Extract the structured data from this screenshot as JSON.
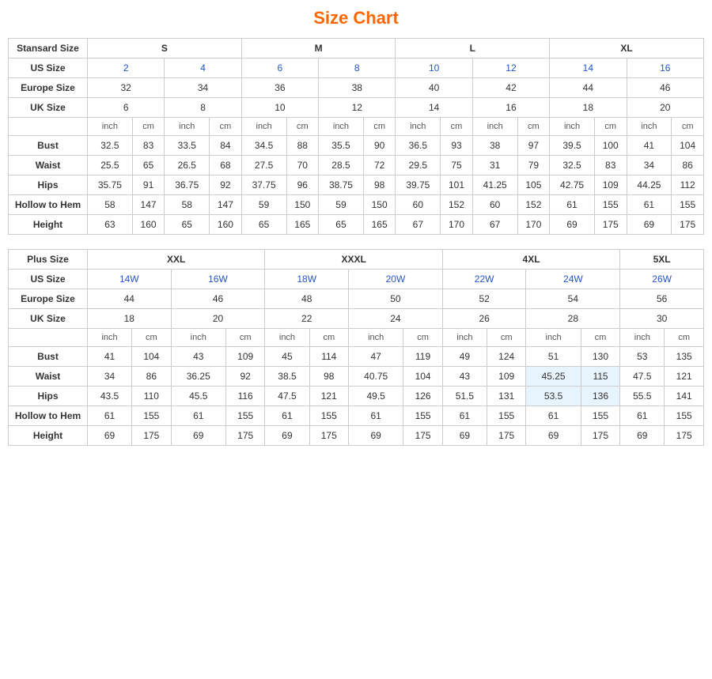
{
  "title": "Size Chart",
  "standard": {
    "headers": {
      "col1": "Stansard Size",
      "s": "S",
      "m": "M",
      "l": "L",
      "xl": "XL"
    },
    "us_size": {
      "label": "US Size",
      "values": [
        "2",
        "4",
        "6",
        "8",
        "10",
        "12",
        "14",
        "16"
      ]
    },
    "europe_size": {
      "label": "Europe Size",
      "values": [
        "32",
        "34",
        "36",
        "38",
        "40",
        "42",
        "44",
        "46"
      ]
    },
    "uk_size": {
      "label": "UK Size",
      "values": [
        "6",
        "8",
        "10",
        "12",
        "14",
        "16",
        "18",
        "20"
      ]
    },
    "unit_row": [
      "inch",
      "cm",
      "inch",
      "cm",
      "inch",
      "cm",
      "inch",
      "cm",
      "inch",
      "cm",
      "inch",
      "cm",
      "inch",
      "cm",
      "inch",
      "cm"
    ],
    "bust": {
      "label": "Bust",
      "values": [
        "32.5",
        "83",
        "33.5",
        "84",
        "34.5",
        "88",
        "35.5",
        "90",
        "36.5",
        "93",
        "38",
        "97",
        "39.5",
        "100",
        "41",
        "104"
      ]
    },
    "waist": {
      "label": "Waist",
      "values": [
        "25.5",
        "65",
        "26.5",
        "68",
        "27.5",
        "70",
        "28.5",
        "72",
        "29.5",
        "75",
        "31",
        "79",
        "32.5",
        "83",
        "34",
        "86"
      ]
    },
    "hips": {
      "label": "Hips",
      "values": [
        "35.75",
        "91",
        "36.75",
        "92",
        "37.75",
        "96",
        "38.75",
        "98",
        "39.75",
        "101",
        "41.25",
        "105",
        "42.75",
        "109",
        "44.25",
        "112"
      ]
    },
    "hollow": {
      "label": "Hollow to Hem",
      "values": [
        "58",
        "147",
        "58",
        "147",
        "59",
        "150",
        "59",
        "150",
        "60",
        "152",
        "60",
        "152",
        "61",
        "155",
        "61",
        "155"
      ]
    },
    "height": {
      "label": "Height",
      "values": [
        "63",
        "160",
        "65",
        "160",
        "65",
        "165",
        "65",
        "165",
        "67",
        "170",
        "67",
        "170",
        "69",
        "175",
        "69",
        "175"
      ]
    }
  },
  "plus": {
    "headers": {
      "col1": "Plus Size",
      "xxl": "XXL",
      "xxxl": "XXXL",
      "fourxl": "4XL",
      "fivexl": "5XL"
    },
    "us_size": {
      "label": "US Size",
      "values": [
        "14W",
        "16W",
        "18W",
        "20W",
        "22W",
        "24W",
        "26W"
      ]
    },
    "europe_size": {
      "label": "Europe Size",
      "values": [
        "44",
        "46",
        "48",
        "50",
        "52",
        "54",
        "56"
      ]
    },
    "uk_size": {
      "label": "UK Size",
      "values": [
        "18",
        "20",
        "22",
        "24",
        "26",
        "28",
        "30"
      ]
    },
    "unit_row": [
      "inch",
      "cm",
      "inch",
      "cm",
      "inch",
      "cm",
      "inch",
      "cm",
      "inch",
      "cm",
      "inch",
      "cm",
      "inch",
      "cm"
    ],
    "bust": {
      "label": "Bust",
      "values": [
        "41",
        "104",
        "43",
        "109",
        "45",
        "114",
        "47",
        "119",
        "49",
        "124",
        "51",
        "130",
        "53",
        "135"
      ]
    },
    "waist": {
      "label": "Waist",
      "values": [
        "34",
        "86",
        "36.25",
        "92",
        "38.5",
        "98",
        "40.75",
        "104",
        "43",
        "109",
        "45.25",
        "115",
        "47.5",
        "121"
      ]
    },
    "hips": {
      "label": "Hips",
      "values": [
        "43.5",
        "110",
        "45.5",
        "116",
        "47.5",
        "121",
        "49.5",
        "126",
        "51.5",
        "131",
        "53.5",
        "136",
        "55.5",
        "141"
      ]
    },
    "hollow": {
      "label": "Hollow to Hem",
      "values": [
        "61",
        "155",
        "61",
        "155",
        "61",
        "155",
        "61",
        "155",
        "61",
        "155",
        "61",
        "155",
        "61",
        "155"
      ]
    },
    "height": {
      "label": "Height",
      "values": [
        "69",
        "175",
        "69",
        "175",
        "69",
        "175",
        "69",
        "175",
        "69",
        "175",
        "69",
        "175",
        "69",
        "175"
      ]
    }
  }
}
